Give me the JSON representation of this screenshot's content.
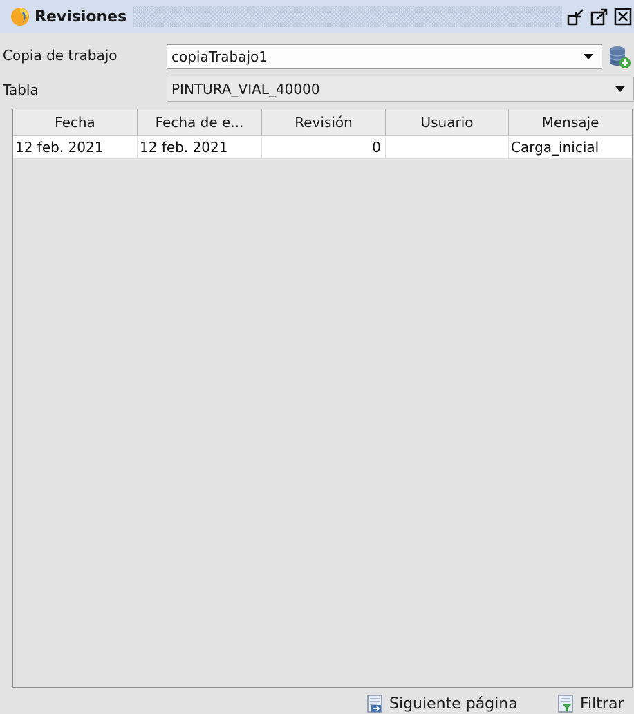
{
  "window": {
    "title": "Revisiones",
    "icons": [
      "app-logo-icon",
      "minimize-dock-icon",
      "maximize-icon",
      "close-icon"
    ]
  },
  "form": {
    "working_copy": {
      "label": "Copia de trabajo",
      "value": "copiaTrabajo1"
    },
    "table": {
      "label": "Tabla",
      "value": "PINTURA_VIAL_40000"
    },
    "add_icon": "database-add-icon"
  },
  "grid": {
    "columns": [
      "Fecha",
      "Fecha de e...",
      "Revisión",
      "Usuario",
      "Mensaje"
    ],
    "rows": [
      {
        "fecha": "12 feb. 2021",
        "fecha_e": "12 feb. 2021",
        "revision": "0",
        "usuario": "",
        "mensaje": "Carga_inicial"
      }
    ]
  },
  "actions": {
    "next_page": {
      "label": "Siguiente página",
      "icon": "next-page-icon"
    },
    "filter": {
      "label": "Filtrar",
      "icon": "filter-icon"
    }
  },
  "colors": {
    "titlebar": "#d4deef",
    "background": "#e3e3e3",
    "accent": "#f5a623"
  }
}
